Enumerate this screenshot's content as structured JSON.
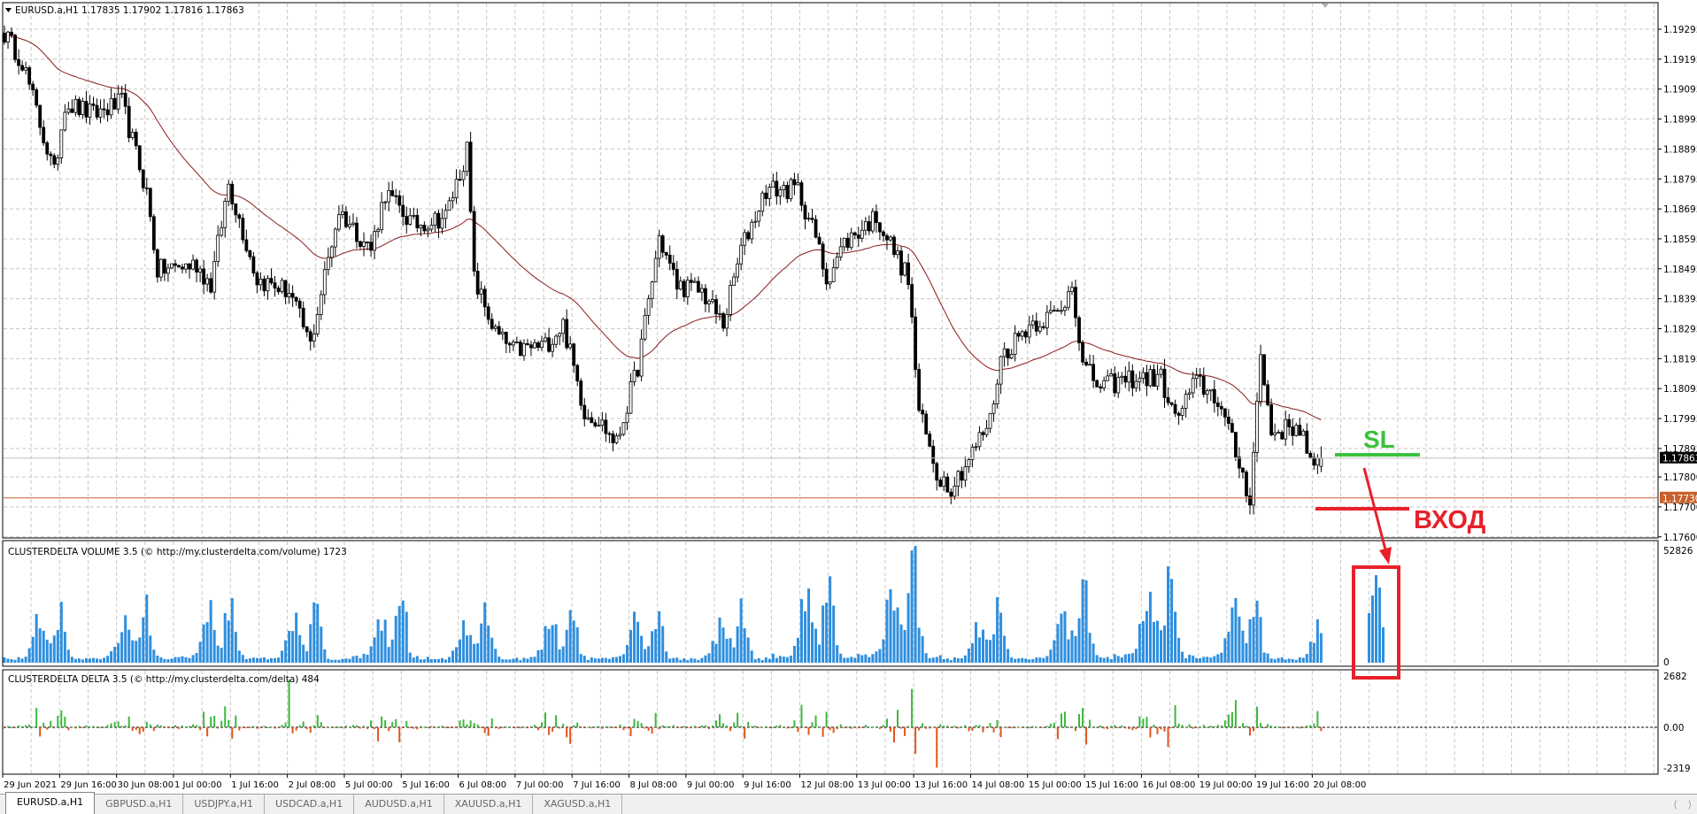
{
  "window": {
    "symbol_header": "EURUSD.a,H1  1.17835 1.17902 1.17816 1.17863",
    "tabs": [
      {
        "label": "EURUSD.a,H1",
        "active": true
      },
      {
        "label": "GBPUSD.a,H1",
        "active": false
      },
      {
        "label": "USDJPY.a,H1",
        "active": false
      },
      {
        "label": "USDCAD.a,H1",
        "active": false
      },
      {
        "label": "AUDUSD.a,H1",
        "active": false
      },
      {
        "label": "XAUUSD.a,H1",
        "active": false
      },
      {
        "label": "XAGUSD.a,H1",
        "active": false
      }
    ],
    "scroll_left_icon": "chevron-left-icon",
    "scroll_right_icon": "chevron-right-icon"
  },
  "colors": {
    "bull_body": "#ffffff",
    "bear_body": "#000000",
    "ma_line": "#8b1a1a",
    "bid_line": "#c0c0c0",
    "level_line": "#c8602a",
    "volume_bar": "#2f8fdf",
    "delta_positive": "#3cb83c",
    "delta_negative": "#e0561b",
    "annotation_green": "#3cc23c",
    "annotation_red": "#e8202a"
  },
  "annotations": {
    "sl_label": "SL",
    "entry_label": "ВХОД"
  },
  "chart_data": [
    {
      "type": "candlestick",
      "title": "EURUSD.a,H1",
      "ohlc_last": {
        "open": 1.17835,
        "high": 1.17902,
        "low": 1.17816,
        "close": 1.17863
      },
      "ylim": [
        1.176,
        1.194
      ],
      "y_ticks": [
        "1.19295",
        "1.19195",
        "1.19095",
        "1.18995",
        "1.18895",
        "1.18795",
        "1.18695",
        "1.18595",
        "1.18495",
        "1.18395",
        "1.18295",
        "1.18195",
        "1.18095",
        "1.17995",
        "1.17895",
        "1.17800",
        "1.17700",
        "1.17600"
      ],
      "current_price_label": "1.17863",
      "level_label": "1.17730",
      "current_price": 1.17863,
      "level_price": 1.1773,
      "x_ticks": [
        "29 Jun 2021",
        "29 Jun 16:00",
        "30 Jun 08:00",
        "1 Jul 00:00",
        "1 Jul 16:00",
        "2 Jul 08:00",
        "5 Jul 00:00",
        "5 Jul 16:00",
        "6 Jul 08:00",
        "7 Jul 00:00",
        "7 Jul 16:00",
        "8 Jul 08:00",
        "9 Jul 00:00",
        "9 Jul 16:00",
        "12 Jul 08:00",
        "13 Jul 00:00",
        "13 Jul 16:00",
        "14 Jul 08:00",
        "15 Jul 00:00",
        "15 Jul 16:00",
        "16 Jul 08:00",
        "19 Jul 00:00",
        "19 Jul 16:00",
        "20 Jul 08:00"
      ],
      "trading_days": [
        "29 Jun",
        "30 Jun",
        "1 Jul",
        "2 Jul",
        "5 Jul",
        "6 Jul",
        "7 Jul",
        "8 Jul",
        "9 Jul",
        "12 Jul",
        "13 Jul",
        "14 Jul",
        "15 Jul",
        "16 Jul",
        "19 Jul",
        "20 Jul"
      ],
      "close_path": [
        [
          "29 Jun 00:00",
          1.1928
        ],
        [
          "29 Jun 05:00",
          1.1919
        ],
        [
          "29 Jun 14:00",
          1.1881
        ],
        [
          "29 Jun 17:00",
          1.1905
        ],
        [
          "30 Jun 01:00",
          1.1901
        ],
        [
          "30 Jun 09:00",
          1.1905
        ],
        [
          "30 Jun 16:00",
          1.1875
        ],
        [
          "30 Jun 19:00",
          1.1849
        ],
        [
          "1 Jul 06:00",
          1.1851
        ],
        [
          "1 Jul 10:00",
          1.1844
        ],
        [
          "1 Jul 15:00",
          1.1878
        ],
        [
          "1 Jul 23:00",
          1.1846
        ],
        [
          "2 Jul 08:00",
          1.1842
        ],
        [
          "2 Jul 14:00",
          1.1824
        ],
        [
          "2 Jul 19:00",
          1.1853
        ],
        [
          "2 Jul 22:00",
          1.1869
        ],
        [
          "5 Jul 07:00",
          1.1856
        ],
        [
          "5 Jul 11:00",
          1.1875
        ],
        [
          "5 Jul 19:00",
          1.1864
        ],
        [
          "6 Jul 04:00",
          1.1867
        ],
        [
          "6 Jul 10:00",
          1.1889
        ],
        [
          "6 Jul 12:00",
          1.1846
        ],
        [
          "6 Jul 18:00",
          1.1828
        ],
        [
          "6 Jul 23:00",
          1.1822
        ],
        [
          "7 Jul 08:00",
          1.1824
        ],
        [
          "7 Jul 13:00",
          1.1831
        ],
        [
          "7 Jul 19:00",
          1.1802
        ],
        [
          "7 Jul 23:00",
          1.1799
        ],
        [
          "8 Jul 04:00",
          1.1791
        ],
        [
          "8 Jul 10:00",
          1.1817
        ],
        [
          "8 Jul 16:00",
          1.186
        ],
        [
          "8 Jul 21:00",
          1.1844
        ],
        [
          "9 Jul 04:00",
          1.1842
        ],
        [
          "9 Jul 10:00",
          1.1831
        ],
        [
          "9 Jul 15:00",
          1.1856
        ],
        [
          "9 Jul 22:00",
          1.1876
        ],
        [
          "12 Jul 07:00",
          1.1876
        ],
        [
          "12 Jul 12:00",
          1.186
        ],
        [
          "12 Jul 15:00",
          1.1846
        ],
        [
          "12 Jul 20:00",
          1.1858
        ],
        [
          "13 Jul 05:00",
          1.1867
        ],
        [
          "13 Jul 08:00",
          1.186
        ],
        [
          "13 Jul 14:00",
          1.1846
        ],
        [
          "13 Jul 17:00",
          1.1802
        ],
        [
          "13 Jul 22:00",
          1.1781
        ],
        [
          "14 Jul 02:00",
          1.1777
        ],
        [
          "14 Jul 06:00",
          1.1784
        ],
        [
          "14 Jul 13:00",
          1.1799
        ],
        [
          "14 Jul 16:00",
          1.182
        ],
        [
          "15 Jul 00:00",
          1.1831
        ],
        [
          "15 Jul 09:00",
          1.1835
        ],
        [
          "15 Jul 12:00",
          1.1846
        ],
        [
          "15 Jul 15:00",
          1.1817
        ],
        [
          "15 Jul 20:00",
          1.181
        ],
        [
          "16 Jul 05:00",
          1.1813
        ],
        [
          "16 Jul 13:00",
          1.1813
        ],
        [
          "16 Jul 17:00",
          1.1799
        ],
        [
          "16 Jul 23:00",
          1.1812
        ],
        [
          "19 Jul 05:00",
          1.1806
        ],
        [
          "19 Jul 10:00",
          1.1788
        ],
        [
          "19 Jul 14:00",
          1.1773
        ],
        [
          "19 Jul 17:00",
          1.182
        ],
        [
          "19 Jul 20:00",
          1.1795
        ],
        [
          "20 Jul 04:00",
          1.1797
        ],
        [
          "20 Jul 08:00",
          1.1781
        ],
        [
          "20 Jul 10:00",
          1.17863
        ]
      ],
      "moving_average": true,
      "grid": true
    },
    {
      "type": "bar",
      "title": "CLUSTERDELTA VOLUME 3.5 (© http://my.clusterdelta.com/volume) 1723",
      "ylim": [
        0,
        52826
      ],
      "y_ticks": [
        "52826",
        "0"
      ],
      "highlighted_bars": [
        22400,
        30400,
        39600,
        34000,
        16000
      ],
      "grid": true
    },
    {
      "type": "bar",
      "title": "CLUSTERDELTA DELTA 3.5 (© http://my.clusterdelta.com/delta) 484",
      "ylim": [
        -2319,
        2682
      ],
      "y_ticks": [
        "2682",
        "0.00",
        "-2319"
      ],
      "grid": true
    }
  ]
}
